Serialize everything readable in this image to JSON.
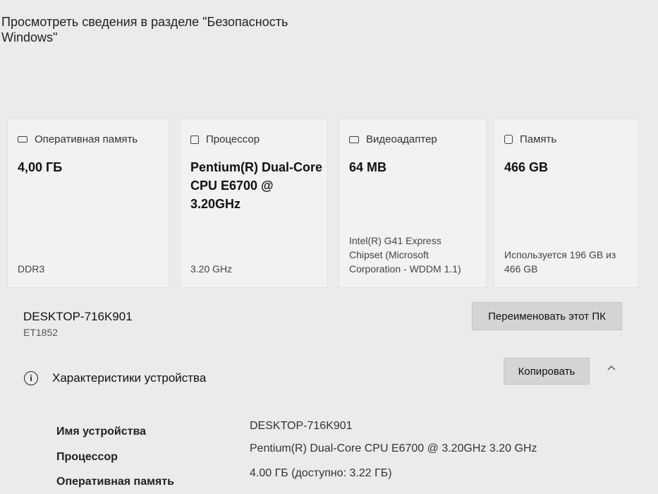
{
  "header": {
    "security_link": "Просмотреть сведения в разделе \"Безопасность Windows\""
  },
  "cards": [
    {
      "icon": "ram-icon",
      "title": "Оперативная память",
      "value": "4,00 ГБ",
      "detail": "DDR3"
    },
    {
      "icon": "cpu-icon",
      "title": "Процессор",
      "value": "Pentium(R) Dual-Core  CPU      E6700 @ 3.20GHz",
      "detail": "3.20 GHz"
    },
    {
      "icon": "gpu-icon",
      "title": "Видеоадаптер",
      "value": "64 MB",
      "detail": "Intel(R) G41 Express Chipset (Microsoft Corporation - WDDM 1.1)"
    },
    {
      "icon": "storage-icon",
      "title": "Память",
      "value": "466 GB",
      "detail": "Используется 196 GB из 466 GB"
    }
  ],
  "device": {
    "name": "DESKTOP-716K901",
    "model": "ET1852",
    "rename_label": "Переименовать этот ПК"
  },
  "specs": {
    "title": "Характеристики устройства",
    "copy_label": "Копировать",
    "rows": [
      {
        "label": "Имя устройства",
        "value": "DESKTOP-716K901"
      },
      {
        "label": "Процессор",
        "value": "Pentium(R) Dual-Core  CPU      E6700  @ 3.20GHz   3.20 GHz"
      },
      {
        "label": "Оперативная память",
        "value": "4.00 ГБ (доступно: 3.22 ГБ)"
      }
    ]
  }
}
